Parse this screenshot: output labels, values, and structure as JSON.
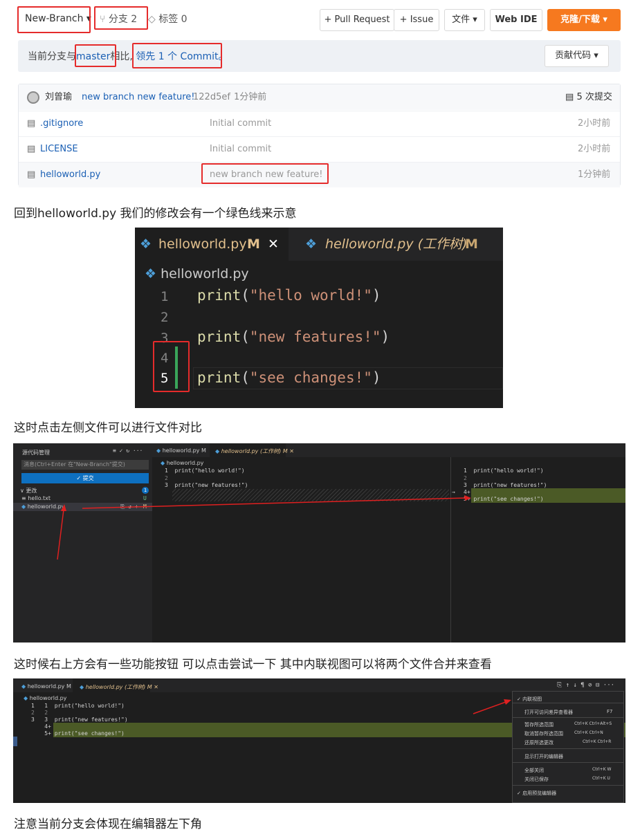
{
  "topbar": {
    "branch": "New-Branch ▾",
    "branches": "分支 2",
    "tags": "标签 0",
    "pull_request": "+ Pull Request",
    "issue": "+ Issue",
    "files": "文件 ▾",
    "web_ide": "Web IDE",
    "clone": "克隆/下载 ▾"
  },
  "compare": {
    "prefix": "当前分支与",
    "base": "master",
    "mid": "相比,",
    "ahead": "领先 1 个 Commit。",
    "contribute": "贡献代码 ▾"
  },
  "commit": {
    "author": "刘曾瑜",
    "message": "new branch new feature!",
    "sha": "122d5ef",
    "time": "1分钟前",
    "count": "5 次提交"
  },
  "files": [
    {
      "name": ".gitignore",
      "msg": "Initial commit",
      "time": "2小时前"
    },
    {
      "name": "LICENSE",
      "msg": "Initial commit",
      "time": "2小时前"
    },
    {
      "name": "helloworld.py",
      "msg": "new branch new feature!",
      "time": "1分钟前"
    }
  ],
  "para1": "回到helloworld.py 我们的修改会有一个绿色线来示意",
  "para2": "这时点击左侧文件可以进行文件对比",
  "para3": "这时候右上方会有一些功能按钮  可以点击尝试一下 其中内联视图可以将两个文件合并来查看",
  "para4": "注意当前分支会体现在编辑器左下角",
  "editor1": {
    "tab1": "helloworld.py",
    "tab1_flag": "M",
    "tab2": "helloworld.py (工作树)",
    "tab2_flag": "M",
    "breadcrumb": "helloworld.py",
    "lines": [
      {
        "n": "1",
        "code": "print(\"hello world!\")"
      },
      {
        "n": "2",
        "code": ""
      },
      {
        "n": "3",
        "code": "print(\"new features!\")"
      },
      {
        "n": "4",
        "code": ""
      },
      {
        "n": "5",
        "code": "print(\"see changes!\")"
      }
    ]
  },
  "editor2": {
    "panel_title": "源代码管理",
    "msg_placeholder": "消息(Ctrl+Enter 在\"New-Branch\"提交)",
    "commit_btn": "✓ 提交",
    "changes": "更改",
    "badge": "1",
    "file1": "hello.txt",
    "file1_flag": "U",
    "file2": "helloworld.py",
    "file2_flag": "M",
    "tab1": "helloworld.py M",
    "tab2": "helloworld.py (工作树) M",
    "breadcrumb": "helloworld.py",
    "left_lines": [
      "1  print(\"hello world!\")",
      "2",
      "3  print(\"new features!\")"
    ],
    "right_lines": [
      "1  print(\"hello world!\")",
      "2",
      "3  print(\"new features!\")",
      "4+",
      "5+ print(\"see changes!\")"
    ]
  },
  "editor3": {
    "tab1": "helloworld.py M",
    "tab2": "helloworld.py (工作树) M",
    "breadcrumb": "helloworld.py",
    "lines": [
      "1   1  print(\"hello world!\")",
      "2   2",
      "3   3  print(\"new features!\")",
      "    4+",
      "    5+ print(\"see changes!\")"
    ],
    "menu": [
      {
        "label": "✓ 内联视图",
        "key": ""
      },
      {
        "label": "打开可访问差异查看器",
        "key": "F7"
      },
      {
        "label": "暂存所选范围",
        "key": "Ctrl+K Ctrl+Alt+S"
      },
      {
        "label": "取消暂存所选范围",
        "key": "Ctrl+K Ctrl+N"
      },
      {
        "label": "还原所选更改",
        "key": "Ctrl+K Ctrl+R"
      },
      {
        "label": "显示打开的编辑器",
        "key": ""
      },
      {
        "label": "全部关闭",
        "key": "Ctrl+K W"
      },
      {
        "label": "关闭已保存",
        "key": "Ctrl+K U"
      },
      {
        "label": "✓ 启用预览编辑器",
        "key": ""
      }
    ]
  }
}
